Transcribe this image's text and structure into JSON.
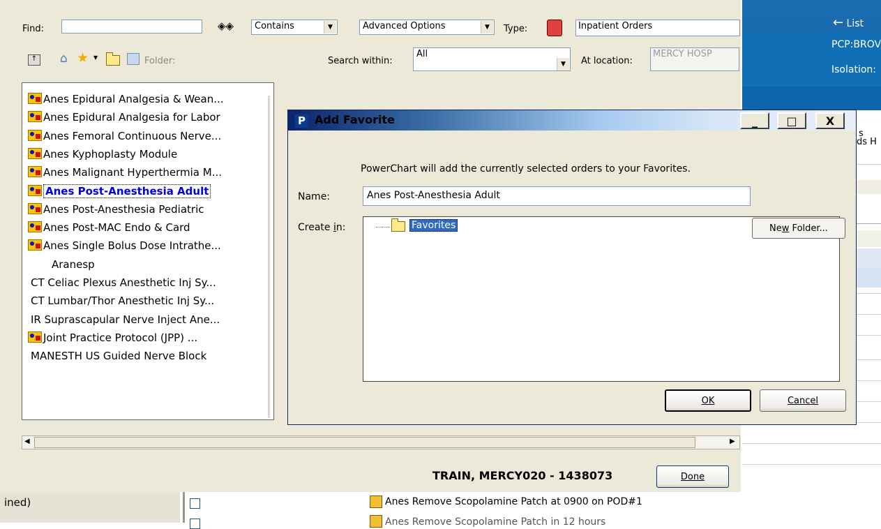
{
  "main": {
    "find_label": "Find:",
    "find_value": "",
    "match_select": "Contains",
    "advanced_select": "Advanced Options",
    "type_label": "Type:",
    "type_value": "Inpatient Orders",
    "folder_label": "Folder:",
    "search_within_label": "Search within:",
    "search_within_value": "All",
    "at_location_label": "At location:",
    "at_location_value": "MERCY HOSP",
    "list_items": [
      {
        "label": "Anes Epidural Analgesia & Wean...",
        "badge": true
      },
      {
        "label": "Anes Epidural Analgesia for Labor",
        "badge": true
      },
      {
        "label": "Anes Femoral Continuous Nerve...",
        "badge": true
      },
      {
        "label": "Anes Kyphoplasty Module",
        "badge": true
      },
      {
        "label": "Anes Malignant Hyperthermia M...",
        "badge": true
      },
      {
        "label": "Anes Post-Anesthesia Adult",
        "badge": true,
        "selected": true
      },
      {
        "label": "Anes Post-Anesthesia Pediatric",
        "badge": true
      },
      {
        "label": "Anes Post-MAC Endo & Card",
        "badge": true
      },
      {
        "label": "Anes Single Bolus Dose Intrathe...",
        "badge": true
      },
      {
        "label": "Aranesp",
        "badge": false
      },
      {
        "label": "CT Celiac Plexus Anesthetic Inj Sy...",
        "badge": false
      },
      {
        "label": "CT Lumbar/Thor Anesthetic Inj Sy...",
        "badge": false
      },
      {
        "label": "IR Suprascapular Nerve Inject Ane...",
        "badge": false
      },
      {
        "label": "Joint Practice Protocol (JPP) ...",
        "badge": true
      },
      {
        "label": "MANESTH US Guided Nerve Block",
        "badge": false
      }
    ],
    "patient_banner": "TRAIN, MERCY020 - 1438073",
    "done_button": "Done"
  },
  "background": {
    "list_button": "List",
    "pcp": "PCP:BROV",
    "isolation": "Isolation:",
    "right_text_1": "s",
    "right_text_2": "eds H",
    "status_text": "ined)",
    "bottom_order": "Anes Remove Scopolamine Patch at 0900 on POD#1",
    "bottom_order_2": "Anes Remove Scopolamine Patch in 12 hours"
  },
  "dialog": {
    "title": "Add Favorite",
    "message": "PowerChart will add the currently selected orders to your Favorites.",
    "name_label": "Name:",
    "name_value": "Anes Post-Anesthesia Adult",
    "create_in_label": "Create in:",
    "tree_item": "Favorites",
    "new_folder_button": "New Folder...",
    "ok_button": "OK",
    "cancel_button": "Cancel",
    "min_glyph": "_",
    "max_glyph": "□",
    "close_glyph": "X"
  }
}
